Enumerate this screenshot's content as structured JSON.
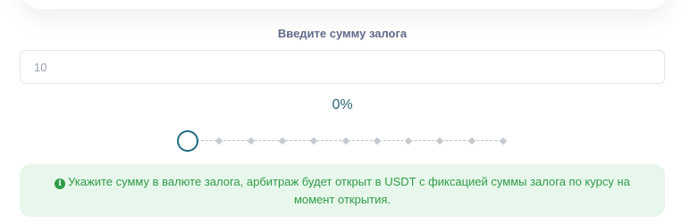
{
  "collateral": {
    "label": "Введите сумму залога",
    "input_value": "10"
  },
  "leverage": {
    "percent_label": "0%",
    "value_percent": 0,
    "steps": 11
  },
  "notice": {
    "icon": "info-circle-icon",
    "text": "Укажите сумму в валюте залога, арбитраж будет открыт в USDT с фиксацией суммы залога по курсу на момент открытия."
  },
  "colors": {
    "label": "#5f6a8a",
    "accent": "#1f6a80",
    "notice_bg": "#e8f7ec",
    "notice_text": "#2e9c47"
  }
}
